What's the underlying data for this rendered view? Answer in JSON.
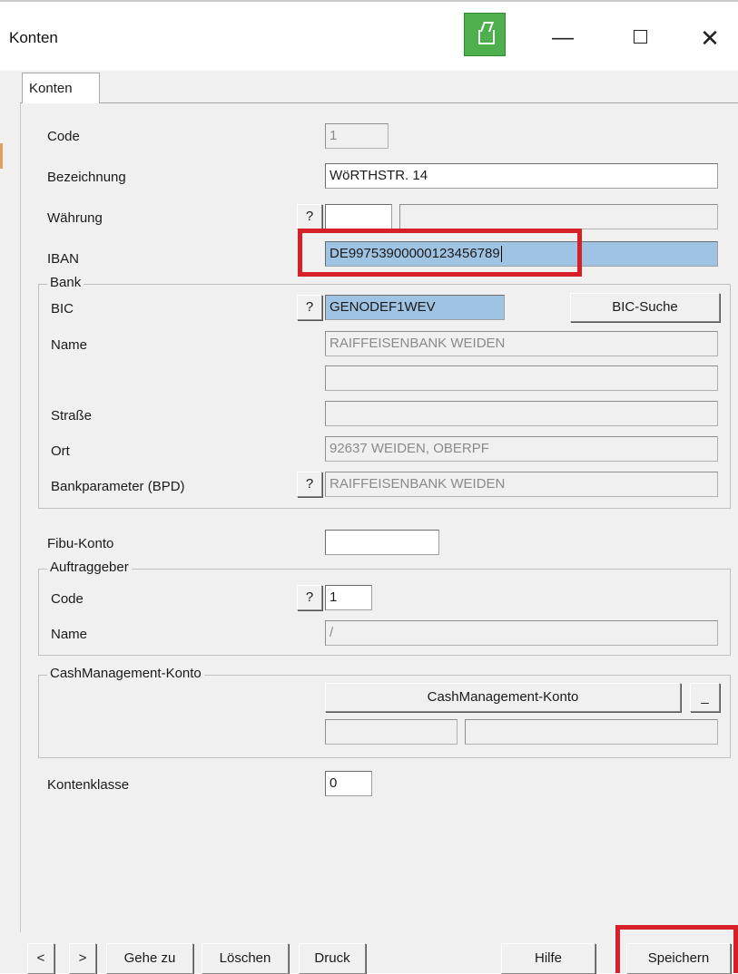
{
  "window": {
    "title": "Konten",
    "min_symbol": "—",
    "close_symbol": "✕"
  },
  "tabs": [
    {
      "label": "Konten"
    }
  ],
  "form": {
    "code": {
      "label": "Code",
      "value": "1"
    },
    "bezeichnung": {
      "label": "Bezeichnung",
      "value": "WöRTHSTR. 14"
    },
    "waehrung": {
      "label": "Währung",
      "value": "",
      "description": ""
    },
    "iban": {
      "label": "IBAN",
      "value": "DE99753900000123456789"
    },
    "lookup_symbol": "?",
    "bank": {
      "title": "Bank",
      "bic": {
        "label": "BIC",
        "value": "GENODEF1WEV"
      },
      "bic_search_label": "BIC-Suche",
      "name": {
        "label": "Name",
        "value": "RAIFFEISENBANK WEIDEN",
        "value2": ""
      },
      "strasse": {
        "label": "Straße",
        "value": ""
      },
      "ort": {
        "label": "Ort",
        "value": "92637 WEIDEN, OBERPF"
      },
      "bpd": {
        "label": "Bankparameter (BPD)",
        "value": "RAIFFEISENBANK WEIDEN"
      }
    },
    "fibu_konto": {
      "label": "Fibu-Konto",
      "value": ""
    },
    "auftraggeber": {
      "title": "Auftraggeber",
      "code": {
        "label": "Code",
        "value": "1"
      },
      "name": {
        "label": "Name",
        "value": "/"
      }
    },
    "cash_management": {
      "title": "CashManagement-Konto",
      "button_label": "CashManagement-Konto",
      "dots_label": "_",
      "field1": "",
      "field2": ""
    },
    "kontenklasse": {
      "label": "Kontenklasse",
      "value": "0"
    }
  },
  "bottom_bar": {
    "prev": "<",
    "next": ">",
    "goto": "Gehe zu",
    "delete": "Löschen",
    "print": "Druck",
    "help": "Hilfe",
    "save": "Speichern"
  },
  "colors": {
    "window_bg": "#f0f0f0",
    "selection": "#9fc3e3",
    "highlight": "#d61f26",
    "app_icon": "#4db04d"
  }
}
